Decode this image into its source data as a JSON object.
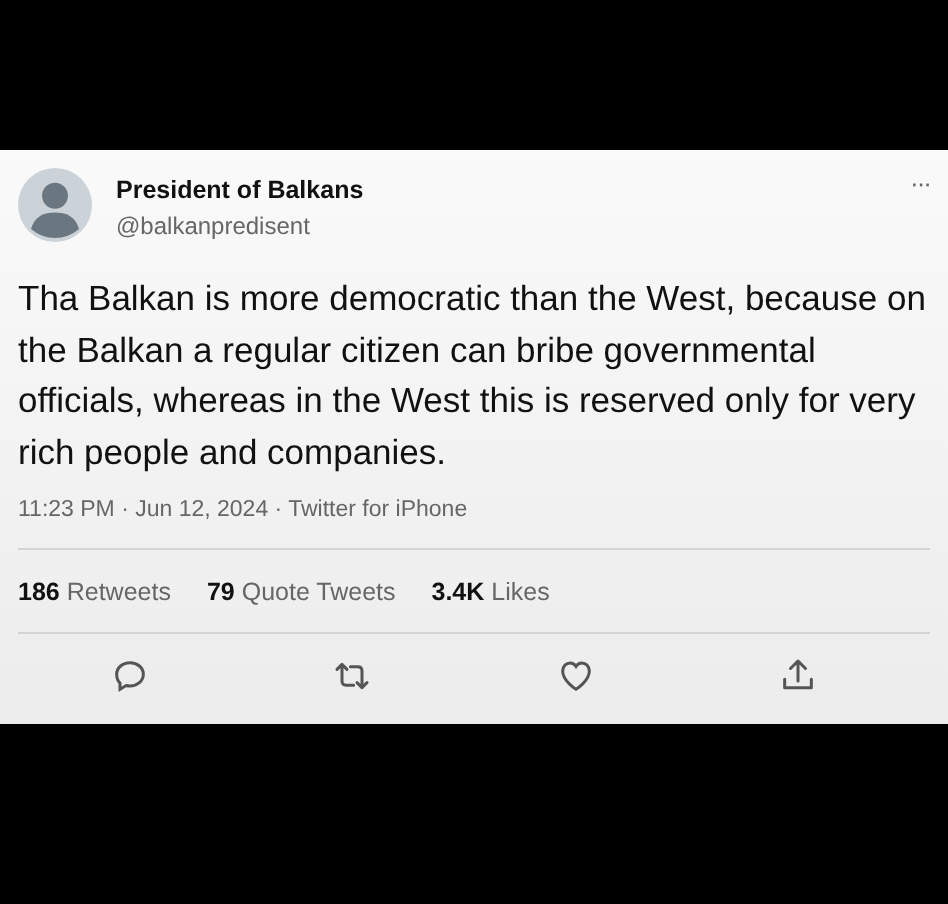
{
  "tweet": {
    "author": {
      "name": "President of Balkans",
      "handle": "@balkanpredisent"
    },
    "more": "···",
    "text": "Tha Balkan is more democratic than the West, because on the Balkan a regular citizen can bribe governmental officials, whereas in the West this is reserved only for very rich people and companies.",
    "meta": "11:23 PM · Jun 12, 2024 · Twitter for iPhone",
    "stats": [
      {
        "count": "186",
        "label": "Retweets"
      },
      {
        "count": "79",
        "label": "Quote Tweets"
      },
      {
        "count": "3.4K",
        "label": "Likes"
      }
    ],
    "actions": [
      {
        "kind": "reply"
      },
      {
        "kind": "retweet"
      },
      {
        "kind": "like"
      },
      {
        "kind": "share"
      }
    ]
  }
}
